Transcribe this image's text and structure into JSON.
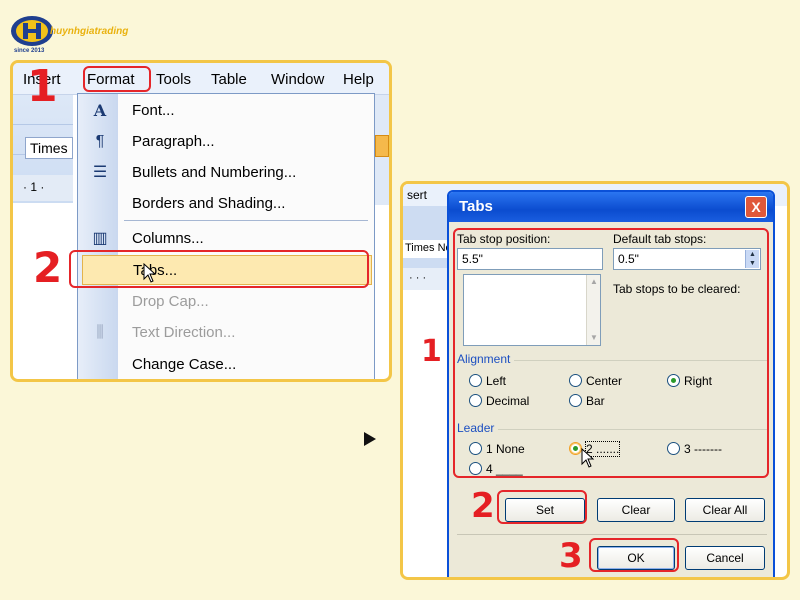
{
  "logo": {
    "name": "huynhgiatrading",
    "since": "since 2013"
  },
  "left_panel": {
    "menubar": [
      "Insert",
      "Format",
      "Tools",
      "Table",
      "Window",
      "Help"
    ],
    "font_name": "Times",
    "ruler_text": "· 1 ·",
    "menu_items": [
      {
        "label": "Font...",
        "icon": "font-icon"
      },
      {
        "label": "Paragraph...",
        "icon": "paragraph-icon"
      },
      {
        "label": "Bullets and Numbering...",
        "icon": "bullets-icon"
      },
      {
        "label": "Borders and Shading...",
        "icon": ""
      },
      {
        "label": "Columns...",
        "icon": "columns-icon"
      },
      {
        "label": "Tabs...",
        "icon": "",
        "highlighted": true
      },
      {
        "label": "Drop Cap...",
        "icon": "",
        "disabled": true
      },
      {
        "label": "Text Direction...",
        "icon": "text-direction-icon",
        "disabled": true
      },
      {
        "label": "Change Case...",
        "icon": ""
      }
    ],
    "step_labels": [
      "1",
      "2"
    ]
  },
  "right_panel": {
    "bg_menu": "sert",
    "bg_font": "Times Ne",
    "dialog": {
      "title": "Tabs",
      "close_label": "X",
      "tab_stop_position_label": "Tab stop position:",
      "tab_stop_position_value": "5.5\"",
      "default_tab_stops_label": "Default tab stops:",
      "default_tab_stops_value": "0.5\"",
      "tab_stops_cleared_label": "Tab stops to be cleared:",
      "alignment_label": "Alignment",
      "alignment_options": [
        "Left",
        "Center",
        "Right",
        "Decimal",
        "Bar"
      ],
      "alignment_selected": "Right",
      "leader_label": "Leader",
      "leader_options": [
        "1 None",
        "2 .......",
        "3 -------",
        "4 ____"
      ],
      "leader_selected": "2 .......",
      "buttons": {
        "set": "Set",
        "clear": "Clear",
        "clear_all": "Clear All",
        "ok": "OK",
        "cancel": "Cancel"
      }
    },
    "step_labels": [
      "1",
      "2",
      "3"
    ]
  },
  "colors": {
    "highlight_red": "#e5262a",
    "panel_border": "#f3c647",
    "title_blue": "#0b4ccf"
  }
}
